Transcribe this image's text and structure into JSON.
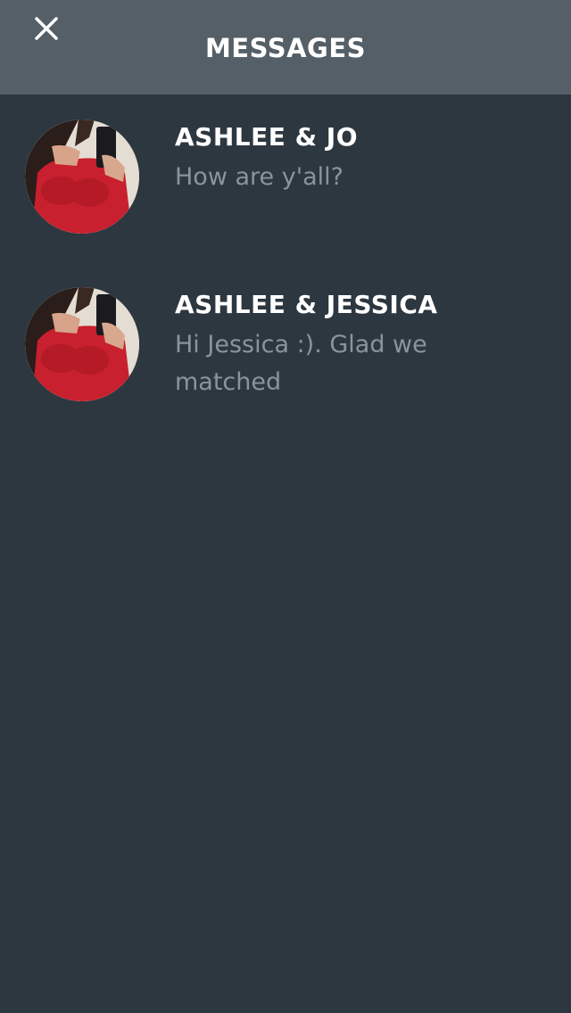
{
  "header": {
    "title": "MESSAGES",
    "close_icon": "close-icon"
  },
  "conversations": [
    {
      "name": "ASHLEE & JO",
      "preview": "How are y'all?",
      "avatar": "avatar-photo"
    },
    {
      "name": "ASHLEE & JESSICA",
      "preview": "Hi Jessica :). Glad we matched",
      "avatar": "avatar-photo"
    }
  ],
  "colors": {
    "background": "#2d3740",
    "header": "#555f67",
    "name": "#ffffff",
    "preview": "#8a949c",
    "avatar_shirt": "#c8202e"
  }
}
